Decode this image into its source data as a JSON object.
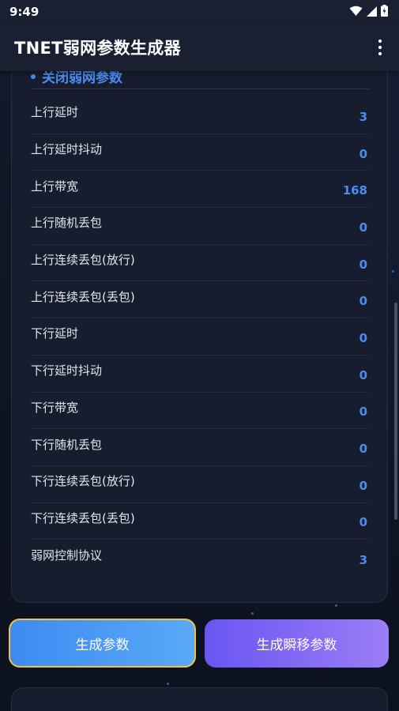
{
  "status": {
    "time": "9:49"
  },
  "app": {
    "title": "TNET弱网参数生成器",
    "menu_icon": "more-vert-icon"
  },
  "section": {
    "title": "关闭弱网参数"
  },
  "params": [
    {
      "label": "上行延时",
      "value": "3"
    },
    {
      "label": "上行延时抖动",
      "value": "0"
    },
    {
      "label": "上行带宽",
      "value": "168"
    },
    {
      "label": "上行随机丢包",
      "value": "0"
    },
    {
      "label": "上行连续丢包(放行)",
      "value": "0"
    },
    {
      "label": "上行连续丢包(丢包)",
      "value": "0"
    },
    {
      "label": "下行延时",
      "value": "0"
    },
    {
      "label": "下行延时抖动",
      "value": "0"
    },
    {
      "label": "下行带宽",
      "value": "0"
    },
    {
      "label": "下行随机丢包",
      "value": "0"
    },
    {
      "label": "下行连续丢包(放行)",
      "value": "0"
    },
    {
      "label": "下行连续丢包(丢包)",
      "value": "0"
    },
    {
      "label": "弱网控制协议",
      "value": "3"
    }
  ],
  "buttons": {
    "generate": "生成参数",
    "migrate": "生成瞬移参数"
  },
  "colors": {
    "accent": "#4a8df0",
    "background": "#0f1424",
    "card": "#171d2e",
    "generate_border": "#f0c24b"
  }
}
